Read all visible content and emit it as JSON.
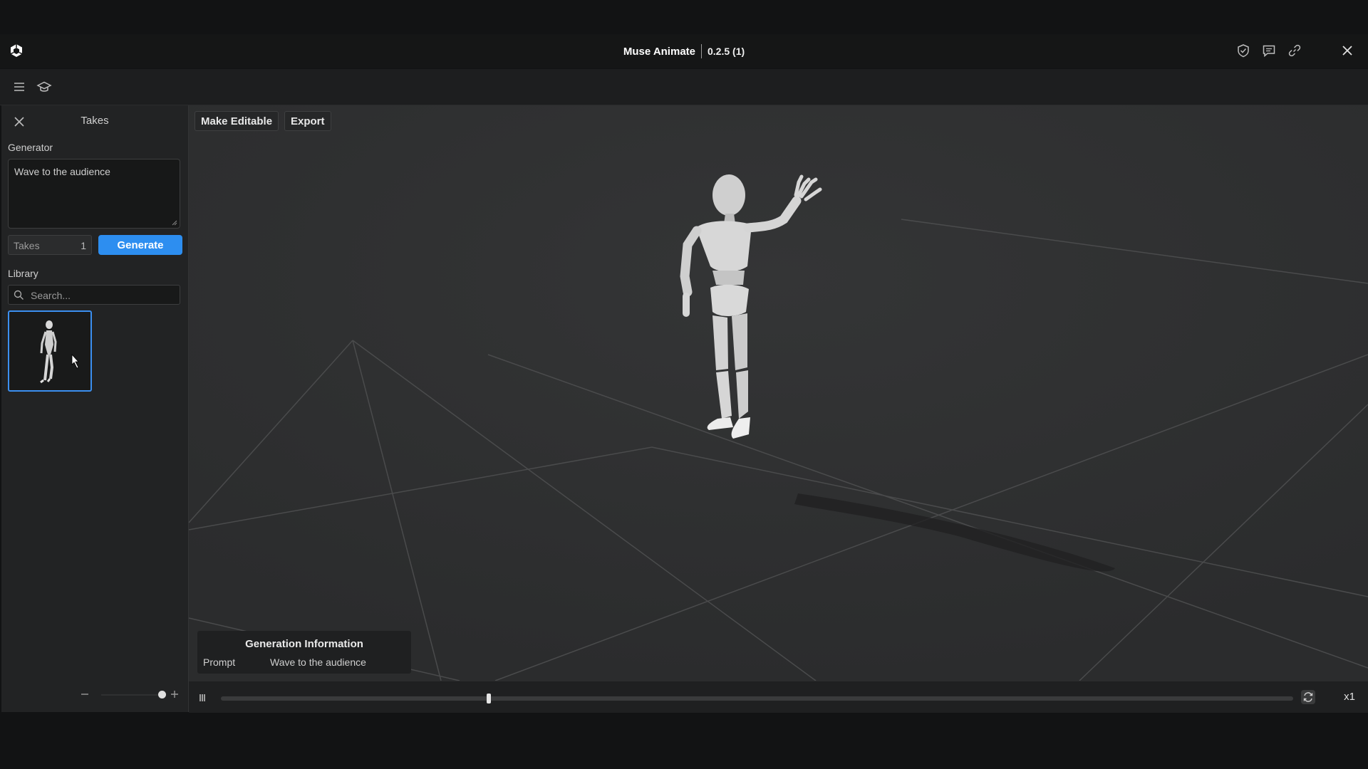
{
  "window": {
    "app_title": "Muse Animate",
    "version": "0.2.5 (1)"
  },
  "top_icons": [
    "shield-check-icon",
    "chat-icon",
    "link-icon",
    "close-icon"
  ],
  "sidebar": {
    "title": "Takes",
    "generator_label": "Generator",
    "prompt_value": "Wave to the audience",
    "takes_label": "Takes",
    "takes_value": "1",
    "generate_label": "Generate",
    "library_label": "Library",
    "search_placeholder": "Search..."
  },
  "viewport": {
    "make_editable_label": "Make Editable",
    "export_label": "Export",
    "generation_info": {
      "title": "Generation Information",
      "prompt_key": "Prompt",
      "prompt_value": "Wave to the audience"
    }
  },
  "timeline": {
    "progress": 0.25,
    "speed_label": "x1"
  },
  "colors": {
    "accent": "#2d8ef0",
    "viewport_bg": "#2f3031",
    "panel_bg": "#222324"
  }
}
